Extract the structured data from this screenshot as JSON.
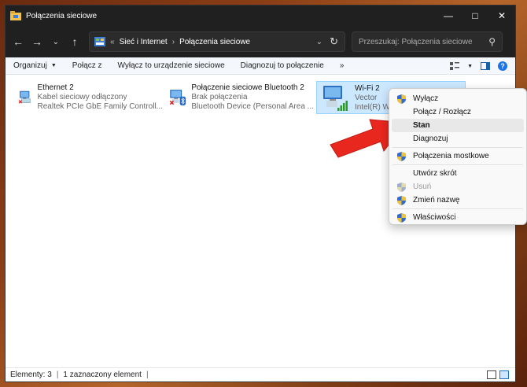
{
  "window": {
    "title": "Połączenia sieciowe"
  },
  "address": {
    "crumbs": [
      "Sieć i Internet",
      "Połączenia sieciowe"
    ],
    "overflow": "«"
  },
  "search": {
    "placeholder": "Przeszukaj: Połączenia sieciowe"
  },
  "toolbar": {
    "organize": "Organizuj",
    "connect": "Połącz z",
    "disable": "Wyłącz to urządzenie sieciowe",
    "diagnose": "Diagnozuj to połączenie",
    "more": "»"
  },
  "connections": [
    {
      "name": "Ethernet 2",
      "status": "Kabel sieciowy odłączony",
      "device": "Realtek PCIe GbE Family Controll..."
    },
    {
      "name": "Połączenie sieciowe Bluetooth 2",
      "status": "Brak połączenia",
      "device": "Bluetooth Device (Personal Area ..."
    },
    {
      "name": "Wi-Fi 2",
      "status": "Vector",
      "device": "Intel(R) Wire"
    }
  ],
  "context_menu": {
    "items": [
      {
        "label": "Wyłącz",
        "shield": true
      },
      {
        "label": "Połącz / Rozłącz",
        "shield": false
      },
      {
        "label": "Stan",
        "shield": false,
        "bold": true
      },
      {
        "label": "Diagnozuj",
        "shield": false
      },
      {
        "label": "Połączenia mostkowe",
        "shield": true
      },
      {
        "label": "Utwórz skrót",
        "shield": false
      },
      {
        "label": "Usuń",
        "shield": true,
        "disabled": true
      },
      {
        "label": "Zmień nazwę",
        "shield": true
      },
      {
        "label": "Właściwości",
        "shield": true
      }
    ]
  },
  "status": {
    "count": "Elementy: 3",
    "selected": "1 zaznaczony element",
    "cursor": "|"
  },
  "colors": {
    "accent": "#0067c0",
    "selection": "#cce8ff",
    "arrow": "#e8281e",
    "titlebar": "#202020"
  }
}
